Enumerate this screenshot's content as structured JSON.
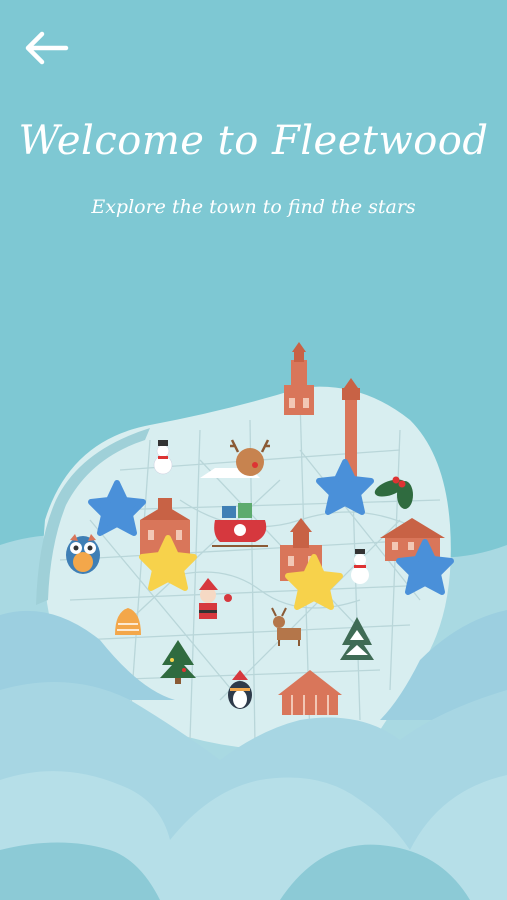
{
  "header": {
    "back_icon": "arrow-left-icon",
    "title": "Welcome to Fleetwood",
    "subtitle": "Explore the town to find the stars"
  },
  "colors": {
    "background": "#7ec8d3",
    "map_land": "#d8eef0",
    "wave_light": "#a9d9e2",
    "wave_mid": "#9ccfe0",
    "star_blue": "#4a90d9",
    "star_yellow": "#f7d24b",
    "building": "#d9765a",
    "road": "#b9d6d9"
  },
  "map": {
    "stars": [
      {
        "name": "star-blue-west",
        "color": "blue",
        "found": false
      },
      {
        "name": "star-yellow-west",
        "color": "yellow",
        "found": true
      },
      {
        "name": "star-blue-northeast",
        "color": "blue",
        "found": false
      },
      {
        "name": "star-yellow-center",
        "color": "yellow",
        "found": true
      },
      {
        "name": "star-blue-east",
        "color": "blue",
        "found": false
      }
    ],
    "landmarks": [
      "lighthouse-icon",
      "tall-lighthouse-icon",
      "snowman-icon",
      "reindeer-icon",
      "holly-icon",
      "owl-icon",
      "sleigh-icon",
      "town-hall-icon",
      "church-icon",
      "house-icon",
      "santa-icon",
      "bell-icon",
      "reindeer-small-icon",
      "christmas-tree-icon",
      "snowy-tree-icon",
      "penguin-icon",
      "market-hall-icon"
    ]
  }
}
